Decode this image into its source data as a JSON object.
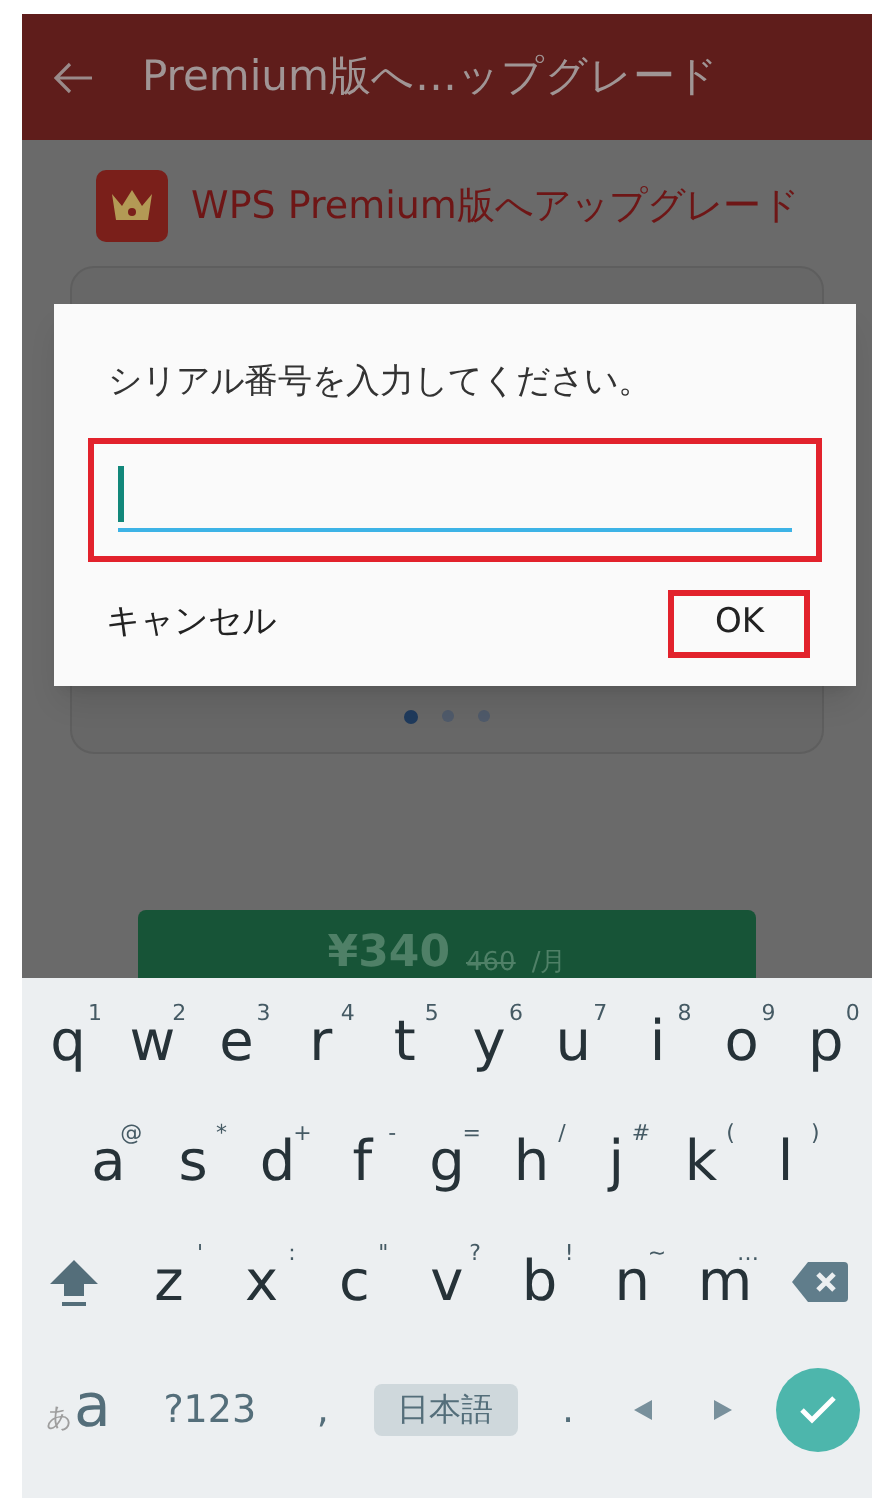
{
  "app_bar": {
    "title": "Premium版へ…ップグレード"
  },
  "header": {
    "title": "WPS Premium版へアップグレード"
  },
  "carousel": {
    "dots": [
      {
        "selected": true
      },
      {
        "selected": false
      },
      {
        "selected": false
      }
    ]
  },
  "price_button": {
    "price": "¥340",
    "old_price": "460",
    "unit": "/月"
  },
  "dialog": {
    "message": "シリアル番号を入力してください。",
    "field": {
      "highlighted": true
    },
    "buttons": [
      {
        "label": "キャンセル",
        "highlighted": false
      },
      {
        "label": "OK",
        "highlighted": true
      }
    ]
  },
  "keyboard": {
    "rows": [
      {
        "keys": [
          {
            "kind": "letter",
            "label": "q",
            "hint": "1"
          },
          {
            "kind": "letter",
            "label": "w",
            "hint": "2"
          },
          {
            "kind": "letter",
            "label": "e",
            "hint": "3"
          },
          {
            "kind": "letter",
            "label": "r",
            "hint": "4"
          },
          {
            "kind": "letter",
            "label": "t",
            "hint": "5"
          },
          {
            "kind": "letter",
            "label": "y",
            "hint": "6"
          },
          {
            "kind": "letter",
            "label": "u",
            "hint": "7"
          },
          {
            "kind": "letter",
            "label": "i",
            "hint": "8"
          },
          {
            "kind": "letter",
            "label": "o",
            "hint": "9"
          },
          {
            "kind": "letter",
            "label": "p",
            "hint": "0"
          }
        ]
      },
      {
        "keys": [
          {
            "kind": "letter",
            "label": "a",
            "hint": "@"
          },
          {
            "kind": "letter",
            "label": "s",
            "hint": "*"
          },
          {
            "kind": "letter",
            "label": "d",
            "hint": "+"
          },
          {
            "kind": "letter",
            "label": "f",
            "hint": "-"
          },
          {
            "kind": "letter",
            "label": "g",
            "hint": "="
          },
          {
            "kind": "letter",
            "label": "h",
            "hint": "/"
          },
          {
            "kind": "letter",
            "label": "j",
            "hint": "#"
          },
          {
            "kind": "letter",
            "label": "k",
            "hint": "("
          },
          {
            "kind": "letter",
            "label": "l",
            "hint": ")"
          }
        ]
      },
      {
        "keys": [
          {
            "kind": "shift"
          },
          {
            "kind": "letter",
            "label": "z",
            "hint": "'"
          },
          {
            "kind": "letter",
            "label": "x",
            "hint": ":"
          },
          {
            "kind": "letter",
            "label": "c",
            "hint": "\""
          },
          {
            "kind": "letter",
            "label": "v",
            "hint": "?"
          },
          {
            "kind": "letter",
            "label": "b",
            "hint": "!"
          },
          {
            "kind": "letter",
            "label": "n",
            "hint": "~"
          },
          {
            "kind": "letter",
            "label": "m",
            "hint": "…"
          },
          {
            "kind": "backspace"
          }
        ]
      },
      {
        "keys": [
          {
            "kind": "mode",
            "small": "あ",
            "label": "a"
          },
          {
            "kind": "text",
            "label": "?123"
          },
          {
            "kind": "text",
            "label": ","
          },
          {
            "kind": "lang",
            "label": "日本語"
          },
          {
            "kind": "text",
            "label": "."
          },
          {
            "kind": "arrow_left"
          },
          {
            "kind": "arrow_right"
          },
          {
            "kind": "enter"
          }
        ]
      }
    ]
  }
}
